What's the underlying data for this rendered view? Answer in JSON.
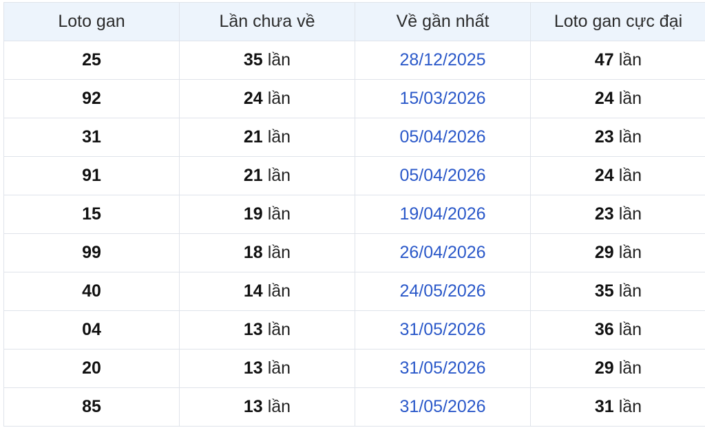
{
  "table": {
    "headers": {
      "loto_gan": "Loto gan",
      "lan_chua_ve": "Lần chưa về",
      "ve_gan_nhat": "Về gần nhất",
      "loto_gan_cuc_dai": "Loto gan cực đại"
    },
    "unit_label": "lần",
    "rows": [
      {
        "number": "25",
        "missed": "35",
        "last_date": "28/12/2025",
        "max_gan": "47"
      },
      {
        "number": "92",
        "missed": "24",
        "last_date": "15/03/2026",
        "max_gan": "24"
      },
      {
        "number": "31",
        "missed": "21",
        "last_date": "05/04/2026",
        "max_gan": "23"
      },
      {
        "number": "91",
        "missed": "21",
        "last_date": "05/04/2026",
        "max_gan": "24"
      },
      {
        "number": "15",
        "missed": "19",
        "last_date": "19/04/2026",
        "max_gan": "23"
      },
      {
        "number": "99",
        "missed": "18",
        "last_date": "26/04/2026",
        "max_gan": "29"
      },
      {
        "number": "40",
        "missed": "14",
        "last_date": "24/05/2026",
        "max_gan": "35"
      },
      {
        "number": "04",
        "missed": "13",
        "last_date": "31/05/2026",
        "max_gan": "36"
      },
      {
        "number": "20",
        "missed": "13",
        "last_date": "31/05/2026",
        "max_gan": "29"
      },
      {
        "number": "85",
        "missed": "13",
        "last_date": "31/05/2026",
        "max_gan": "31"
      }
    ]
  },
  "colors": {
    "header_bg": "#edf4fc",
    "date_link": "#2a58c9",
    "border": "#dfe3ea"
  }
}
